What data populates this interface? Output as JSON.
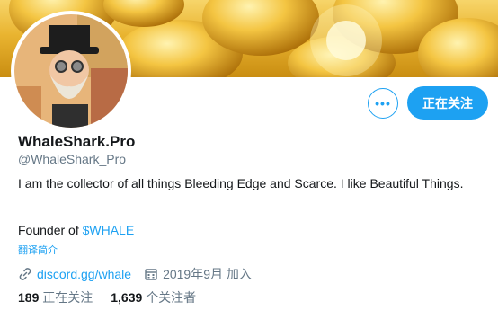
{
  "profile": {
    "display_name": "WhaleShark.Pro",
    "handle": "@WhaleShark_Pro",
    "bio_line": "I am the collector of all things Bleeding Edge and Scarce. I like Beautiful Things.",
    "founder_prefix": "Founder of ",
    "founder_token": "$WHALE",
    "translate_label": "翻译简介",
    "website": "discord.gg/whale",
    "joined": "2019年9月 加入",
    "following_count": "189",
    "following_label": "正在关注",
    "followers_count": "1,639",
    "followers_label": "个关注者"
  },
  "actions": {
    "more_label": "•••",
    "follow_label": "正在关注"
  },
  "colors": {
    "accent": "#1da1f2",
    "secondary_text": "#657786",
    "primary_text": "#14171a"
  }
}
